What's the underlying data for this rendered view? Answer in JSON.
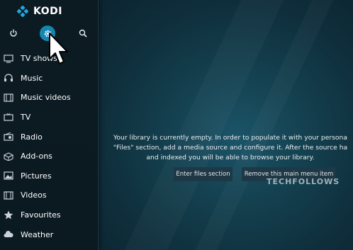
{
  "app": {
    "title": "KODI"
  },
  "top_icons": [
    "power-icon",
    "settings-icon",
    "search-icon"
  ],
  "sidebar": {
    "items": [
      {
        "label": "TV shows",
        "icon": "tv-icon"
      },
      {
        "label": "Music",
        "icon": "headphones-icon"
      },
      {
        "label": "Music videos",
        "icon": "film-icon"
      },
      {
        "label": "TV",
        "icon": "tv-icon"
      },
      {
        "label": "Radio",
        "icon": "radio-icon"
      },
      {
        "label": "Add-ons",
        "icon": "box-icon"
      },
      {
        "label": "Pictures",
        "icon": "picture-icon"
      },
      {
        "label": "Videos",
        "icon": "film-icon"
      },
      {
        "label": "Favourites",
        "icon": "star-icon"
      },
      {
        "label": "Weather",
        "icon": "cloud-icon"
      }
    ]
  },
  "main": {
    "message_lines": [
      "Your library is currently empty. In order to populate it with your persona",
      "\"Files\" section, add a media source and configure it. After the source ha",
      "and indexed you will be able to browse your library."
    ],
    "enter_files_label": "Enter files section",
    "remove_label": "Remove this main menu item"
  },
  "watermark": "TECHFOLLOWS",
  "colors": {
    "accent": "#1686b0",
    "sidebar_bg": "#0c1b22",
    "main_bg": "#14404f"
  }
}
